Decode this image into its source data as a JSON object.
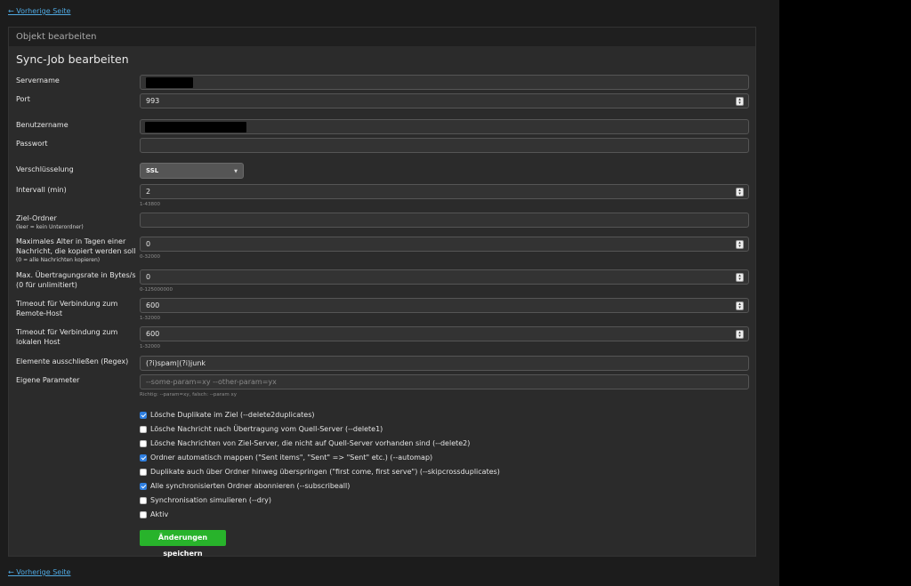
{
  "nav": {
    "back_label": "← Vorherige Seite"
  },
  "panel": {
    "heading": "Objekt bearbeiten",
    "title": "Sync-Job bearbeiten"
  },
  "fields": {
    "servername": {
      "label": "Servername",
      "value": ""
    },
    "port": {
      "label": "Port",
      "value": "993"
    },
    "username": {
      "label": "Benutzername",
      "value": ""
    },
    "password": {
      "label": "Passwort",
      "value": ""
    },
    "encryption": {
      "label": "Verschlüsselung",
      "value": "SSL"
    },
    "interval": {
      "label": "Intervall (min)",
      "value": "2",
      "help": "1-43800"
    },
    "target_folder": {
      "label": "Ziel-Ordner",
      "sub": "(leer = kein Unterordner)",
      "value": ""
    },
    "max_age": {
      "label": "Maximales Alter in Tagen einer Nachricht, die kopiert werden soll",
      "sub": "(0 = alle Nachrichten kopieren)",
      "value": "0",
      "help": "0-32000"
    },
    "max_rate": {
      "label": "Max. Übertragungsrate in Bytes/s (0 für unlimitiert)",
      "value": "0",
      "help": "0-125000000"
    },
    "timeout_remote": {
      "label": "Timeout für Verbindung zum Remote-Host",
      "value": "600",
      "help": "1-32000"
    },
    "timeout_local": {
      "label": "Timeout für Verbindung zum lokalen Host",
      "value": "600",
      "help": "1-32000"
    },
    "exclude": {
      "label": "Elemente ausschließen (Regex)",
      "value": "(?i)spam|(?i)junk"
    },
    "custom_params": {
      "label": "Eigene Parameter",
      "placeholder": "--some-param=xy --other-param=yx",
      "help": "Richtig: --param=xy, falsch: --param xy"
    }
  },
  "checkboxes": [
    {
      "label": "Lösche Duplikate im Ziel (--delete2duplicates)",
      "checked": true
    },
    {
      "label": "Lösche Nachricht nach Übertragung vom Quell-Server (--delete1)",
      "checked": false
    },
    {
      "label": "Lösche Nachrichten von Ziel-Server, die nicht auf Quell-Server vorhanden sind (--delete2)",
      "checked": false
    },
    {
      "label": "Ordner automatisch mappen (\"Sent items\", \"Sent\" => \"Sent\" etc.) (--automap)",
      "checked": true
    },
    {
      "label": "Duplikate auch über Ordner hinweg überspringen (\"first come, first serve\") (--skipcrossduplicates)",
      "checked": false
    },
    {
      "label": "Alle synchronisierten Ordner abonnieren (--subscribeall)",
      "checked": true
    },
    {
      "label": "Synchronisation simulieren (--dry)",
      "checked": false
    },
    {
      "label": "Aktiv",
      "checked": false
    }
  ],
  "save_button": "Änderungen speichern",
  "colors": {
    "accent_green": "#28b32b",
    "checkbox_blue": "#2f7fe0",
    "link": "#4fa8e0"
  }
}
